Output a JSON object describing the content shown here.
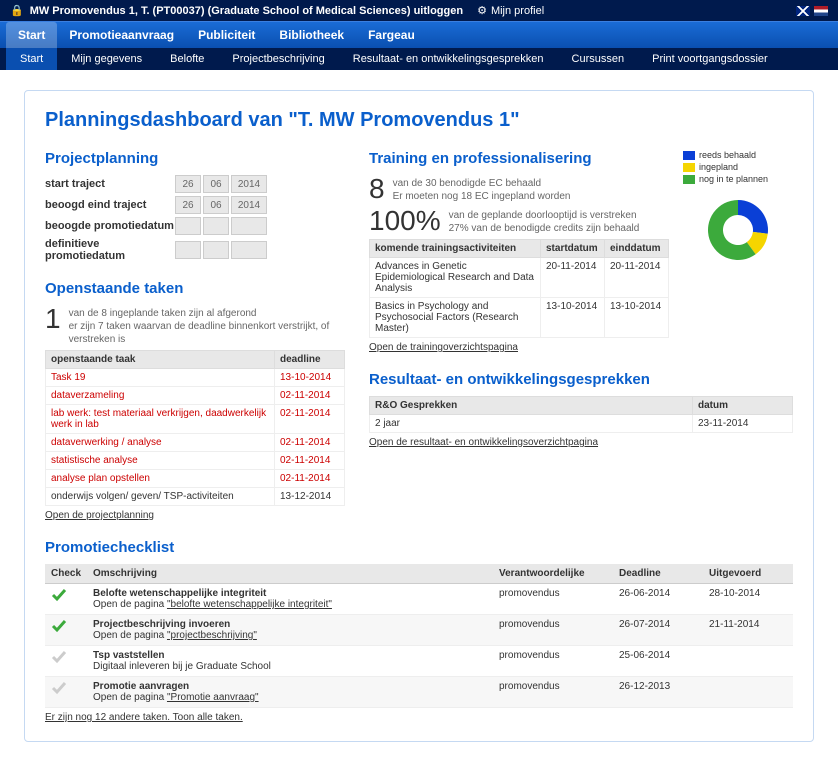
{
  "topbar": {
    "title": "MW Promovendus 1, T. (PT00037) (Graduate School of Medical Sciences) uitloggen",
    "profile": "Mijn profiel"
  },
  "nav1": [
    "Start",
    "Promotieaanvraag",
    "Publiciteit",
    "Bibliotheek",
    "Fargeau"
  ],
  "nav2": [
    "Start",
    "Mijn gegevens",
    "Belofte",
    "Projectbeschrijving",
    "Resultaat- en ontwikkelingsgesprekken",
    "Cursussen",
    "Print voortgangsdossier"
  ],
  "page_title": "Planningsdashboard van \"T. MW Promovendus 1\"",
  "projectplanning": {
    "heading": "Projectplanning",
    "rows": [
      {
        "label": "start traject",
        "d": "26",
        "m": "06",
        "y": "2014"
      },
      {
        "label": "beoogd eind traject",
        "d": "26",
        "m": "06",
        "y": "2014"
      },
      {
        "label": "beoogde promotiedatum",
        "d": "",
        "m": "",
        "y": ""
      },
      {
        "label": "definitieve promotiedatum",
        "d": "",
        "m": "",
        "y": ""
      }
    ]
  },
  "open_tasks": {
    "heading": "Openstaande taken",
    "num": "1",
    "text": "van de 8 ingeplande taken zijn al afgerond\ner zijn 7 taken waarvan de deadline binnenkort verstrijkt, of verstreken is",
    "th1": "openstaande taak",
    "th2": "deadline",
    "rows": [
      {
        "t": "Task 19",
        "d": "13-10-2014",
        "red": true
      },
      {
        "t": "dataverzameling",
        "d": "02-11-2014",
        "red": true
      },
      {
        "t": "lab werk: test materiaal verkrijgen, daadwerkelijk werk in lab",
        "d": "02-11-2014",
        "red": true
      },
      {
        "t": "dataverwerking / analyse",
        "d": "02-11-2014",
        "red": true
      },
      {
        "t": "statistische analyse",
        "d": "02-11-2014",
        "red": true
      },
      {
        "t": "analyse plan opstellen",
        "d": "02-11-2014",
        "red": true
      },
      {
        "t": "onderwijs volgen/ geven/ TSP-activiteiten",
        "d": "13-12-2014",
        "red": false
      }
    ],
    "link": "Open de projectplanning"
  },
  "training": {
    "heading": "Training en professionalisering",
    "n1": "8",
    "t1": "van de 30 benodigde EC behaald\nEr moeten nog 18 EC ingepland worden",
    "n2": "100%",
    "t2": "van de geplande doorlooptijd is verstreken\n27% van de benodigde credits zijn behaald",
    "th1": "komende trainingsactiviteiten",
    "th2": "startdatum",
    "th3": "einddatum",
    "rows": [
      {
        "t": "Advances in Genetic Epidemiological Research and Data Analysis",
        "s": "20-11-2014",
        "e": "20-11-2014"
      },
      {
        "t": "Basics in Psychology and Psychosocial Factors (Research Master)",
        "s": "13-10-2014",
        "e": "13-10-2014"
      }
    ],
    "link": "Open de trainingoverzichtspagina",
    "legend": [
      {
        "label": "reeds behaald",
        "color": "#0a3fd6"
      },
      {
        "label": "ingepland",
        "color": "#f5d500"
      },
      {
        "label": "nog in te plannen",
        "color": "#3caa3c"
      }
    ]
  },
  "ro": {
    "heading": "Resultaat- en ontwikkelingsgesprekken",
    "th1": "R&O Gesprekken",
    "th2": "datum",
    "rows": [
      {
        "t": "2 jaar",
        "d": "23-11-2014"
      }
    ],
    "link": "Open de resultaat- en ontwikkelingsoverzichtpagina"
  },
  "checklist": {
    "heading": "Promotiechecklist",
    "th": [
      "Check",
      "Omschrijving",
      "Verantwoordelijke",
      "Deadline",
      "Uitgevoerd"
    ],
    "rows": [
      {
        "done": true,
        "title": "Belofte wetenschappelijke integriteit",
        "sub": "Open de pagina ",
        "link": "\"belofte wetenschappelijke integriteit\"",
        "who": "promovendus",
        "dl": "26-06-2014",
        "ex": "28-10-2014"
      },
      {
        "done": true,
        "title": "Projectbeschrijving invoeren",
        "sub": "Open de pagina ",
        "link": "\"projectbeschrijving\"",
        "who": "promovendus",
        "dl": "26-07-2014",
        "ex": "21-11-2014"
      },
      {
        "done": false,
        "title": "Tsp vaststellen",
        "sub": "Digitaal inleveren bij je Graduate School",
        "link": "",
        "who": "promovendus",
        "dl": "25-06-2014",
        "ex": ""
      },
      {
        "done": false,
        "title": "Promotie aanvragen",
        "sub": "Open de pagina ",
        "link": "\"Promotie aanvraag\"",
        "who": "promovendus",
        "dl": "26-12-2013",
        "ex": ""
      }
    ],
    "more": "Er zijn nog 12 andere taken. Toon alle taken."
  },
  "chart_data": {
    "type": "pie",
    "title": "",
    "series": [
      {
        "name": "reeds behaald",
        "value": 27,
        "color": "#0a3fd6"
      },
      {
        "name": "ingepland",
        "value": 13,
        "color": "#f5d500"
      },
      {
        "name": "nog in te plannen",
        "value": 60,
        "color": "#3caa3c"
      }
    ]
  }
}
